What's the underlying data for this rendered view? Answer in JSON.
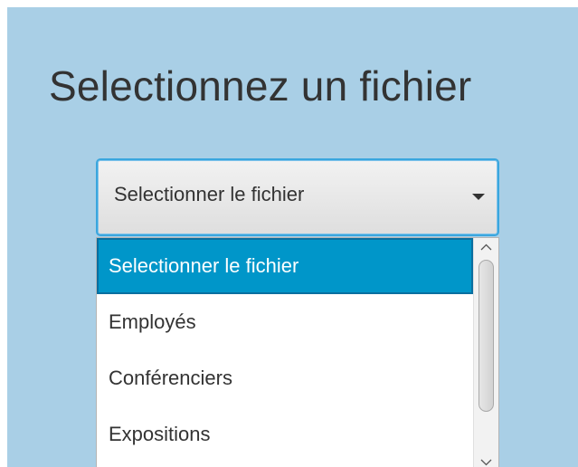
{
  "page": {
    "title": "Selectionnez un fichier"
  },
  "combo": {
    "value": "Selectionner le fichier",
    "arrow_icon": "triangle-down-icon"
  },
  "dropdown": {
    "items": [
      {
        "label": "Selectionner le fichier",
        "selected": true
      },
      {
        "label": "Employés",
        "selected": false
      },
      {
        "label": "Conférenciers",
        "selected": false
      },
      {
        "label": "Expositions",
        "selected": false
      }
    ],
    "scroll_up_icon": "chevron-up-icon",
    "scroll_down_icon": "chevron-down-icon"
  },
  "colors": {
    "background": "#a9cfe6",
    "accent": "#0096c9",
    "focus_border": "#3aa6de"
  }
}
